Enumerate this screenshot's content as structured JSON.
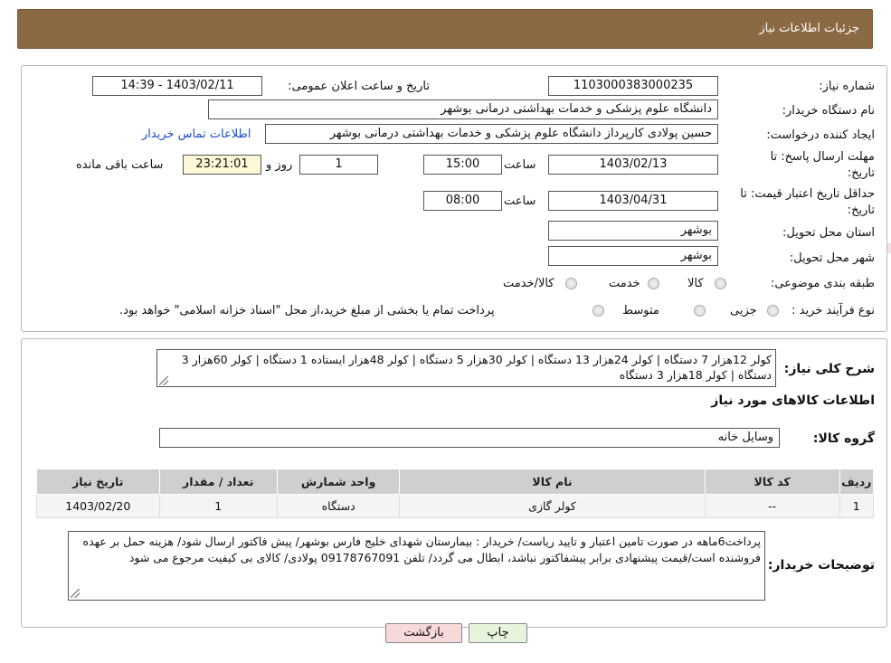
{
  "header": {
    "title": "جزئیات اطلاعات نیاز"
  },
  "form": {
    "need_number_label": "شماره نیاز:",
    "need_number": "1103000383000235",
    "announce_label": "تاریخ و ساعت اعلان عمومی:",
    "announce_value": "1403/02/11 - 14:39",
    "buyer_org_label": "نام دستگاه خریدار:",
    "buyer_org": "دانشگاه علوم پزشکی و خدمات بهداشتی درمانی بوشهر",
    "creator_label": "ایجاد کننده درخواست:",
    "creator": "حسین پولادی کارپرداز دانشگاه علوم پزشکی و خدمات بهداشتی درمانی بوشهر",
    "contact_link": "اطلاعات تماس خریدار",
    "reply_deadline_label_1": "مهلت ارسال پاسخ: تا",
    "reply_deadline_label_2": "تاریخ:",
    "reply_date": "1403/02/13",
    "time_label": "ساعت",
    "reply_time": "15:00",
    "days_value": "1",
    "days_label": "روز و",
    "remaining_time": "23:21:01",
    "remaining_label": "ساعت باقی مانده",
    "price_validity_label_1": "حداقل تاریخ اعتبار قیمت: تا",
    "price_validity_label_2": "تاریخ:",
    "validity_date": "1403/04/31",
    "validity_time": "08:00",
    "province_label": "استان محل تحویل:",
    "province": "بوشهر",
    "city_label": "شهر محل تحویل:",
    "city": "بوشهر",
    "category_label": "طبقه بندی موضوعی:",
    "category_options": [
      "کالا",
      "خدمت",
      "کالا/خدمت"
    ],
    "process_label": "نوع فرآیند خرید :",
    "process_options": [
      "جزیی",
      "متوسط"
    ],
    "process_note": "پرداخت تمام یا بخشی از مبلغ خرید،از محل \"اسناد خزانه اسلامی\" خواهد بود."
  },
  "summary": {
    "label": "شرح کلی نیاز:",
    "text": "کولر 12هزار 7 دستگاه | کولر 24هزار 13 دستگاه | کولر 30هزار 5 دستگاه | کولر 48هزار ایستاده 1 دستگاه | کولر 60هزار 3 دستگاه | کولر 18هزار 3 دستگاه",
    "goods_info_title": "اطلاعات کالاهای مورد نیاز",
    "group_label": "گروه کالا:",
    "group_value": "وسایل خانه"
  },
  "table": {
    "headers": [
      "ردیف",
      "کد کالا",
      "نام کالا",
      "واحد شمارش",
      "تعداد / مقدار",
      "تاریخ نیاز"
    ],
    "rows": [
      [
        "1",
        "--",
        "کولر گازی",
        "دستگاه",
        "1",
        "1403/02/20"
      ]
    ]
  },
  "buyer_notes": {
    "label": "توضیحات خریدار:",
    "text": "پرداخت6ماهه در صورت تامین اعتبار و تایید ریاست/ خریدار : بیمارستان شهدای خلیج فارس بوشهر/ پیش فاکتور ارسال شود/ هزینه حمل بر عهده فروشنده است/قیمت پیشنهادی برابر پیشفاکتور نباشد، ابطال می گردد/ تلفن 09178767091 پولادی/ کالای بی کیفیت مرجوع می شود"
  },
  "buttons": {
    "print": "چاپ",
    "back": "بازگشت"
  },
  "watermark": {
    "text": "AriaTender.neT",
    "color": "#f0caca"
  }
}
